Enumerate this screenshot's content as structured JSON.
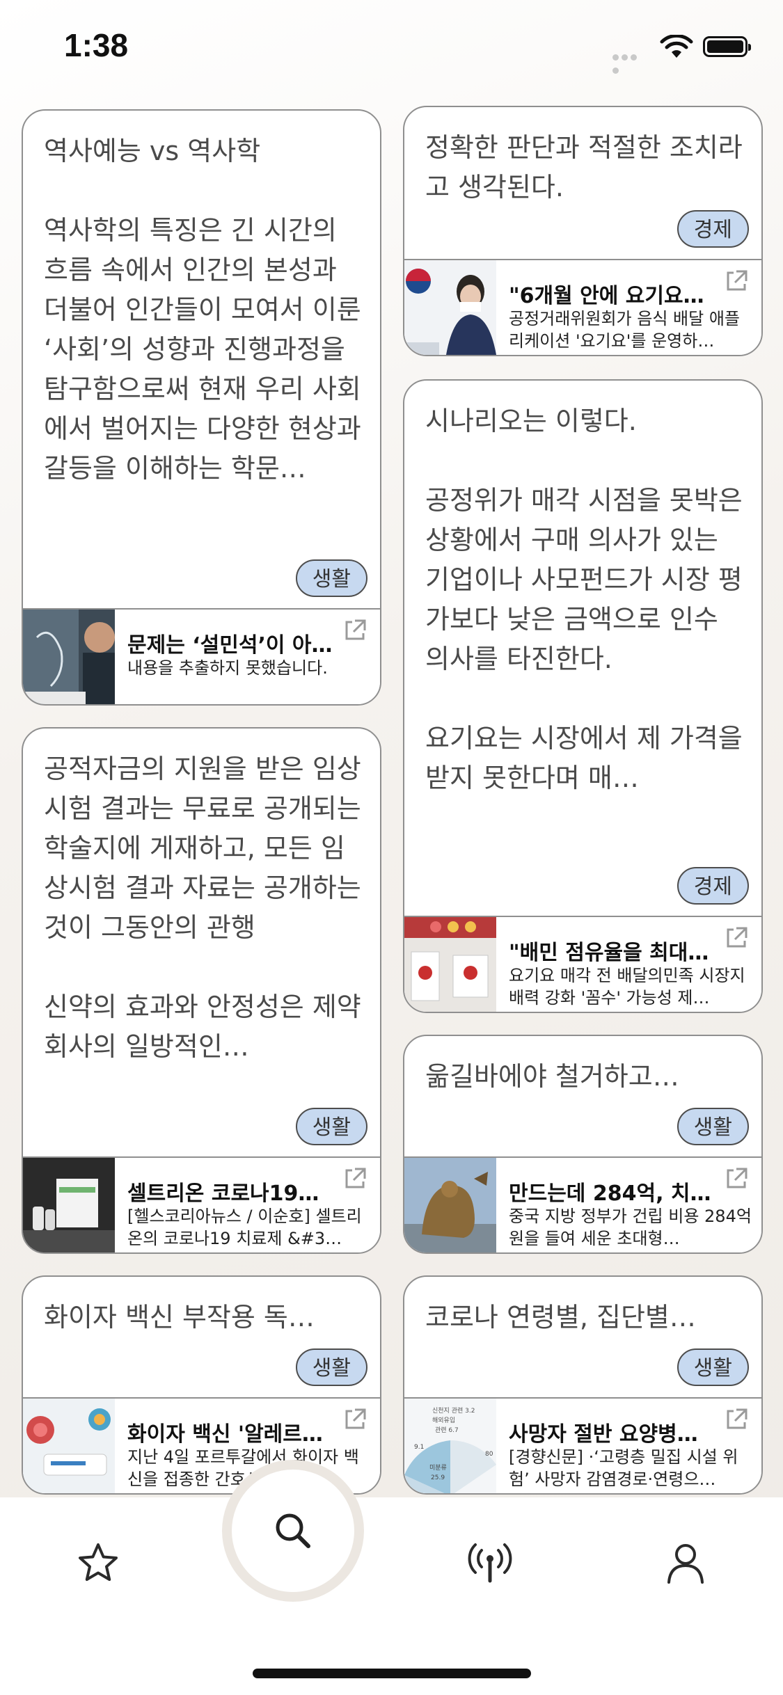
{
  "status": {
    "time": "1:38"
  },
  "cards": [
    {
      "text": "역사예능 vs 역사학\n\n역사학의 특징은 긴 시간의 흐름 속에서 인간의 본성과 더불어 인간들이 모여서 이룬 ‘사회’의 성향과 진행과정을 탐구함으로써 현재 우리 사회에서 벌어지는 다양한 현상과 갈등을 이해하는 학문…",
      "tag": "생활",
      "link_title": "문제는 ‘설민석’이 아…",
      "link_desc": "내용을 추출하지 못했습니다."
    },
    {
      "text": "정확한 판단과 적절한 조치라고 생각된다.",
      "tag": "경제",
      "link_title": "\"6개월 안에 요기요…",
      "link_desc": "공정거래위원회가 음식 배달 애플리케이션 '요기요'를 운영하…"
    },
    {
      "text": "시나리오는 이렇다.\n\n공정위가 매각 시점을 못박은 상황에서 구매 의사가 있는 기업이나 사모펀드가 시장 평가보다 낮은 금액으로 인수 의사를 타진한다.\n\n요기요는 시장에서 제 가격을 받지 못한다며 매…",
      "tag": "경제",
      "link_title": "\"배민 점유율을 최대…",
      "link_desc": "요기요 매각 전 배달의민족 시장지배력 강화 '꼼수' 가능성 제…"
    },
    {
      "text": "공적자금의 지원을 받은 임상시험 결과는 무료로 공개되는 학술지에 게재하고, 모든 임상시험 결과 자료는 공개하는 것이 그동안의 관행\n\n신약의 효과와 안정성은 제약회사의 일방적인…",
      "tag": "생활",
      "link_title": "셀트리온 코로나19…",
      "link_desc": "[헬스코리아뉴스 / 이순호] 셀트리온의 코로나19 치료제 &#3…"
    },
    {
      "text": "욺길바에야 철거하고…",
      "tag": "생활",
      "link_title": "만드는데 284억, 치…",
      "link_desc": "중국 지방 정부가 건립 비용 284억원을 들여 세운 초대형…"
    },
    {
      "text": "화이자 백신 부작용 독…",
      "tag": "생활",
      "link_title": "화이자 백신 '알레르…",
      "link_desc": "지난 4일 포르투갈에서 화이자 백신을 접종한 간호사가 사망…"
    },
    {
      "text": "코로나 연령별, 집단별…",
      "tag": "생활",
      "link_title": "사망자 절반 요양병원…",
      "link_desc": "[경향신문] ·‘고령층 밀집 시설 위험’ 사망자 감염경로·연령으…"
    }
  ],
  "thumb_texts": {
    "chart_labels": [
      "신천지 관련 3.2",
      "해외유입",
      "관련 6.7",
      "미분류",
      "25.9",
      "9.1",
      "80"
    ]
  },
  "tabs": [
    {
      "name": "favorites",
      "icon": "star-icon"
    },
    {
      "name": "search",
      "icon": "search-icon"
    },
    {
      "name": "broadcast",
      "icon": "antenna-icon"
    },
    {
      "name": "profile",
      "icon": "person-icon"
    }
  ],
  "colors": {
    "tag_bg": "#c7d9f0",
    "card_border": "#8f8f8f",
    "background": "#f2efeb"
  }
}
